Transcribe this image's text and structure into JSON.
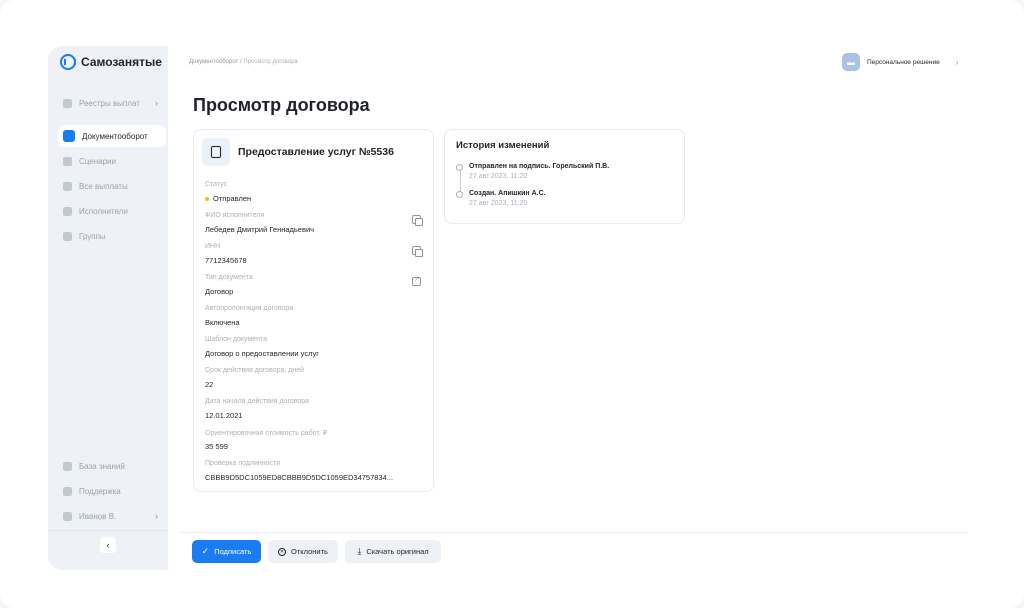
{
  "app": {
    "logo_text": "Самозанятые"
  },
  "sidebar": {
    "items": [
      {
        "label": "Реестры выплат",
        "icon": "registry-icon",
        "has_chevron": true
      },
      {
        "label": "Документооборот",
        "icon": "documents-icon",
        "active": true
      },
      {
        "label": "Сценарии",
        "icon": "scenarios-icon"
      },
      {
        "label": "Все выплаты",
        "icon": "payments-icon"
      },
      {
        "label": "Исполнители",
        "icon": "users-icon"
      },
      {
        "label": "Группы",
        "icon": "groups-icon"
      }
    ],
    "bottom_items": [
      {
        "label": "База знаний",
        "icon": "knowledge-icon"
      },
      {
        "label": "Поддержка",
        "icon": "support-icon"
      },
      {
        "label": "Иванов В.",
        "icon": "user-icon",
        "has_chevron": true
      }
    ],
    "collapse_glyph": "‹"
  },
  "header": {
    "breadcrumb": {
      "parent": "Документооборот",
      "separator": "/",
      "current": "Просмотр договора"
    },
    "persona_label": "Персональное решение"
  },
  "page": {
    "title": "Просмотр договора"
  },
  "document": {
    "title": "Предоставление услуг №5536",
    "fields": [
      {
        "label": "Статус",
        "value": "Отправлен"
      },
      {
        "label": "ФИО исполнителя",
        "value": "Лебедев Дмитрий Геннадьевич"
      },
      {
        "label": "ИНН",
        "value": "7712345678"
      },
      {
        "label": "Тип документа",
        "value": "Договор"
      },
      {
        "label": "Автопролонгация договора",
        "value": "Включена"
      },
      {
        "label": "Шаблон документа",
        "value": "Договор о предоставлении услуг"
      },
      {
        "label": "Срок действия договора, дней",
        "value": "22"
      },
      {
        "label": "Дата начала действия договора",
        "value": "12.01.2021"
      },
      {
        "label": "Ориентировочная стоимость работ, ₽",
        "value": "35 599"
      },
      {
        "label": "Проверка подлинности",
        "value": "CBBB9D5DC1059ED8CBBB9D5DC1059ED34757834..."
      }
    ]
  },
  "history": {
    "title": "История  изменений",
    "items": [
      {
        "text": "Отправлен на подпись. Горельский П.В.",
        "time": "27 авг 2023, 11:20"
      },
      {
        "text": "Создан. Апишкин А.С.",
        "time": "27 авг 2023, 11:20"
      }
    ]
  },
  "actions": {
    "sign": "Подписать",
    "reject": "Отклонить",
    "download": "Скачать оригинал"
  },
  "colors": {
    "accent": "#1a7cf0",
    "status_sent": "#f5b623"
  }
}
